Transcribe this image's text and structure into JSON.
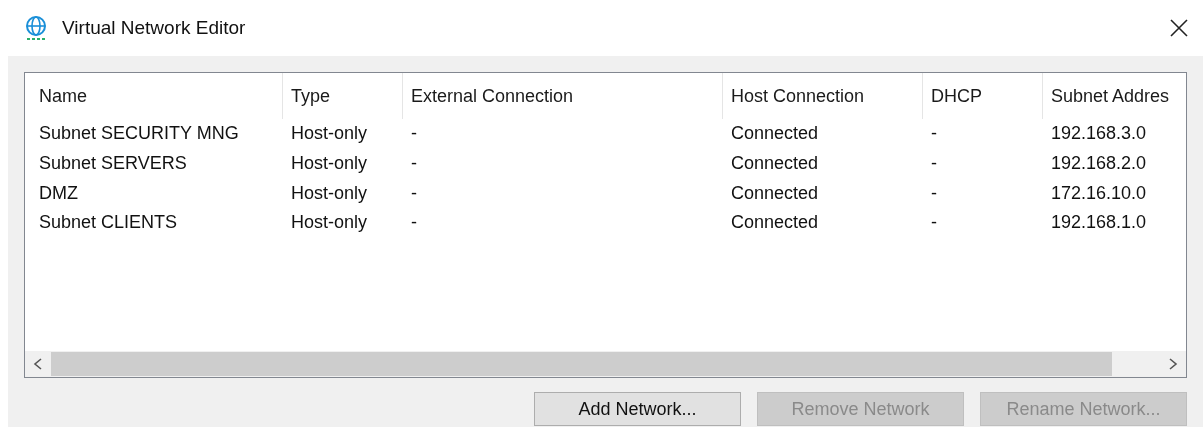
{
  "window": {
    "title": "Virtual Network Editor"
  },
  "table": {
    "columns": [
      "Name",
      "Type",
      "External Connection",
      "Host Connection",
      "DHCP",
      "Subnet Addres"
    ],
    "rows": [
      [
        "Subnet SECURITY MNG",
        "Host-only",
        "-",
        "Connected",
        "-",
        "192.168.3.0"
      ],
      [
        "Subnet SERVERS",
        "Host-only",
        "-",
        "Connected",
        "-",
        "192.168.2.0"
      ],
      [
        "DMZ",
        "Host-only",
        "-",
        "Connected",
        "-",
        "172.16.10.0"
      ],
      [
        "Subnet CLIENTS",
        "Host-only",
        "-",
        "Connected",
        "-",
        "192.168.1.0"
      ]
    ]
  },
  "buttons": [
    {
      "label": "Add Network...",
      "disabled": false
    },
    {
      "label": "Remove Network",
      "disabled": true
    },
    {
      "label": "Rename Network...",
      "disabled": true
    }
  ]
}
